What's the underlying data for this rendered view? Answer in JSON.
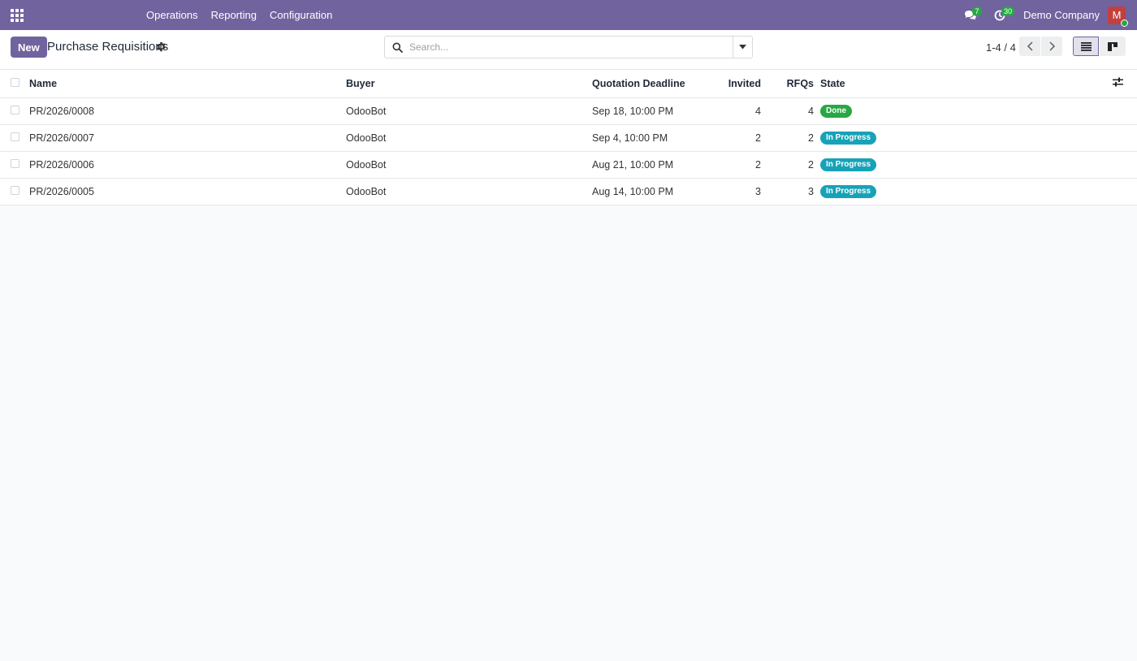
{
  "navbar": {
    "menu": [
      "Operations",
      "Reporting",
      "Configuration"
    ],
    "messages_count": "7",
    "activities_count": "30",
    "company": "Demo Company",
    "avatar_initial": "M"
  },
  "control_panel": {
    "new_label": "New",
    "title": "Purchase Requisitions",
    "search_placeholder": "Search...",
    "pager": "1-4 / 4"
  },
  "table": {
    "headers": {
      "name": "Name",
      "buyer": "Buyer",
      "deadline": "Quotation Deadline",
      "invited": "Invited",
      "rfqs": "RFQs",
      "state": "State"
    },
    "rows": [
      {
        "name": "PR/2026/0008",
        "buyer": "OdooBot",
        "deadline": "Sep 18, 10:00 PM",
        "invited": "4",
        "rfqs": "4",
        "state": "Done"
      },
      {
        "name": "PR/2026/0007",
        "buyer": "OdooBot",
        "deadline": "Sep 4, 10:00 PM",
        "invited": "2",
        "rfqs": "2",
        "state": "In Progress"
      },
      {
        "name": "PR/2026/0006",
        "buyer": "OdooBot",
        "deadline": "Aug 21, 10:00 PM",
        "invited": "2",
        "rfqs": "2",
        "state": "In Progress"
      },
      {
        "name": "PR/2026/0005",
        "buyer": "OdooBot",
        "deadline": "Aug 14, 10:00 PM",
        "invited": "3",
        "rfqs": "3",
        "state": "In Progress"
      }
    ]
  },
  "colors": {
    "brand": "#71639e",
    "done": "#28a745",
    "in_progress": "#17a2b8"
  }
}
